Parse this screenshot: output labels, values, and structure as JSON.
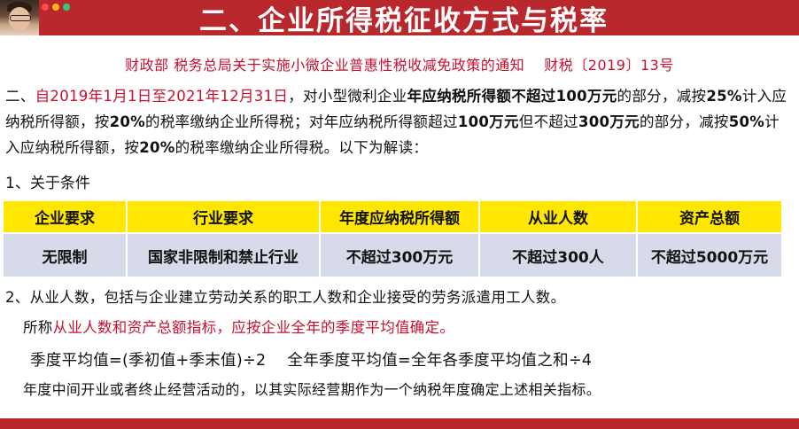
{
  "header": {
    "title": "二、企业所得税征收方式与税率"
  },
  "colors": {
    "title_bar": "#b8282d",
    "accent_red": "#c8102e",
    "table_header_bg": "#ffe700",
    "table_row_bg": "#d7dbe9"
  },
  "notice": {
    "left": "财政部 税务总局关于实施小微企业普惠性税收减免政策的通知",
    "right": "财税〔2019〕13号"
  },
  "paragraph": {
    "p1": "二、",
    "p2": "自2019年1月1日至2021年12月31日",
    "p3": "，对小型微利企业",
    "p4": "年应纳税所得额不超过100万元",
    "p5": "的部分，减按",
    "p6": "25%",
    "p7": "计入应纳税所得额，按",
    "p8": "20%",
    "p9": "的税率缴纳企业所得税；对年应纳税所得额超过",
    "p10": "100万元",
    "p11": "但不超过",
    "p12": "300万元",
    "p13": "的部分，减按",
    "p14": "50%",
    "p15": "计入应纳税所得额，按",
    "p16": "20%",
    "p17": "的税率缴纳企业所得税。以下为解读："
  },
  "section1": {
    "heading": "1、关于条件"
  },
  "conditions_table": {
    "headers": [
      "企业要求",
      "行业要求",
      "年度应纳税所得额",
      "从业人数",
      "资产总额"
    ],
    "row": [
      "无限制",
      "国家非限制和禁止行业",
      "不超过300万元",
      "不超过300人",
      "不超过5000万元"
    ]
  },
  "section2": {
    "line1": "2、从业人数，包括与企业建立劳动关系的职工人数和企业接受的劳务派遣用工人数。",
    "called_prefix": "所称",
    "called_red": "从业人数和资产总额指标，应按企业全年的季度平均值确定。",
    "formula_quarter": "季度平均值=(季初值+季末值)÷2",
    "formula_year": "全年季度平均值=全年各季度平均值之和÷4",
    "line_last": "年度中间开业或者终止经营活动的，以其实际经营期作为一个纳税年度确定上述相关指标。"
  }
}
